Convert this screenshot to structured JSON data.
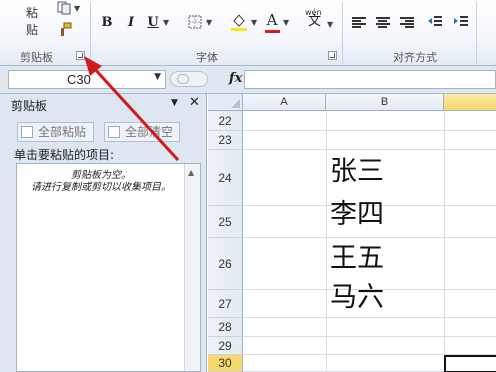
{
  "ribbon": {
    "paste_label": "粘贴",
    "groups": {
      "clipboard": "剪贴板",
      "font": "字体",
      "alignment": "对齐方式"
    },
    "buttons": {
      "bold": "B",
      "italic": "I",
      "underline": "U",
      "font_color": "A",
      "wen": "wén"
    }
  },
  "formula_bar": {
    "name_box": "C30",
    "fx_label": "fx",
    "formula_value": ""
  },
  "clipboard_pane": {
    "title": "剪贴板",
    "paste_all": "全部粘贴",
    "clear_all": "全部清空",
    "instruction": "单击要粘贴的项目:",
    "empty_line1": "剪贴板为空。",
    "empty_line2": "请进行复制或剪切以收集项目。"
  },
  "sheet": {
    "columns": [
      "A",
      "B"
    ],
    "rows": [
      {
        "num": "22",
        "b": ""
      },
      {
        "num": "23",
        "b": ""
      },
      {
        "num": "24",
        "b": "张三"
      },
      {
        "num": "25",
        "b": "李四"
      },
      {
        "num": "26",
        "b": "王五"
      },
      {
        "num": "27",
        "b": "马六"
      },
      {
        "num": "28",
        "b": ""
      },
      {
        "num": "29",
        "b": ""
      },
      {
        "num": "30",
        "b": ""
      }
    ]
  },
  "colors": {
    "ribbon_bg": "#f4f7fb",
    "pane_bg": "#dde6f1",
    "selected_header": "#f7d96e",
    "annotation_arrow": "#d11a1a",
    "font_color_underline": "#e0191d",
    "highlight_underline": "#f5e61d"
  },
  "icons": [
    "copy-icon",
    "format-painter-icon",
    "border-icon",
    "fill-color-icon",
    "font-color-icon",
    "phonetic-icon",
    "align-left-icon",
    "align-center-icon",
    "align-right-icon",
    "indent-decrease-icon",
    "indent-increase-icon",
    "dialog-launcher-icon",
    "chevron-down-icon",
    "close-icon"
  ]
}
